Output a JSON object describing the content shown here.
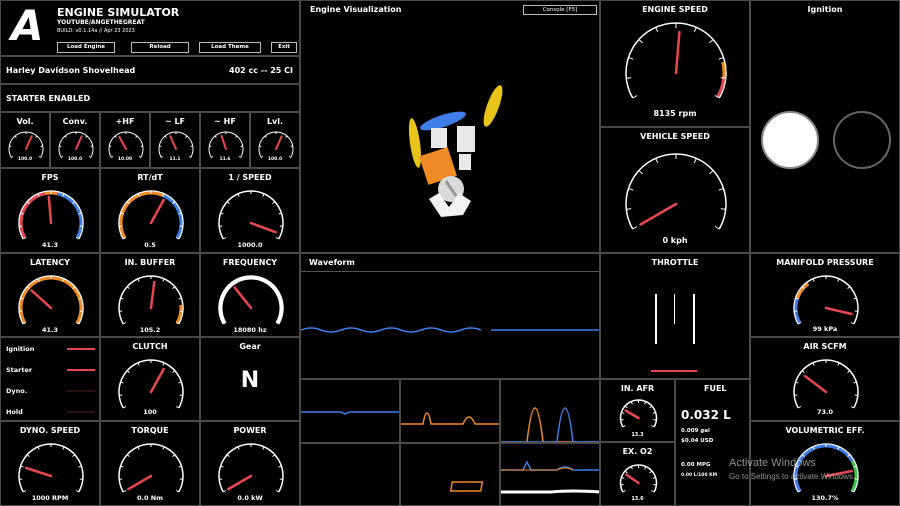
{
  "header": {
    "logo": "A",
    "title": "ENGINE SIMULATOR",
    "subtitle": "YOUTUBE/ANGETHEGREAT",
    "build": "BUILD: v0.1.14a // Apr 23 2023",
    "buttons": [
      "Load Engine",
      "Reload",
      "Load Theme",
      "Exit"
    ]
  },
  "engine": {
    "name": "Harley Davidson Shovelhead",
    "displacement": "402 cc -- 25 CI",
    "starter_status": "STARTER ENABLED"
  },
  "visualization": {
    "title": "Engine Visualization",
    "console_label": "Console [F5]"
  },
  "waveform": {
    "title": "Waveform"
  },
  "ignition": {
    "title": "Ignition"
  },
  "small_gauges": [
    {
      "label": "Vol.",
      "value": "100.0",
      "fraction": 0.6
    },
    {
      "label": "Conv.",
      "value": "100.0",
      "fraction": 0.6
    },
    {
      "label": "+HF",
      "value": "10.00",
      "fraction": 0.38
    },
    {
      "label": "~ LF",
      "value": "11.1",
      "fraction": 0.4
    },
    {
      "label": "~ HF",
      "value": "11.6",
      "fraction": 0.42
    },
    {
      "label": "Lvl.",
      "value": "100.0",
      "fraction": 0.6
    }
  ],
  "gauges": {
    "fps": {
      "label": "FPS",
      "value": "41.3",
      "fraction": 0.48
    },
    "rtdt": {
      "label": "RT/dT",
      "value": "0.5",
      "fraction": 0.62
    },
    "speed_inv": {
      "label": "1 / SPEED",
      "value": "1000.0",
      "fraction": 0.96
    },
    "latency": {
      "label": "LATENCY",
      "value": "41.3",
      "fraction": 0.3
    },
    "inbuffer": {
      "label": "IN. BUFFER",
      "value": "105.2",
      "fraction": 0.53
    },
    "frequency": {
      "label": "FREQUENCY",
      "value": "18080 hz",
      "fraction": 0.34
    },
    "engine_speed": {
      "label": "ENGINE SPEED",
      "value": "8135 rpm",
      "fraction": 0.52
    },
    "vehicle_speed": {
      "label": "VEHICLE SPEED",
      "value": "0 kph",
      "fraction": 0.0
    },
    "clutch": {
      "label": "CLUTCH",
      "value": "100",
      "fraction": 0.62
    },
    "dyno_speed": {
      "label": "DYNO. SPEED",
      "value": "1000 RPM",
      "fraction": 0.2
    },
    "torque": {
      "label": "TORQUE",
      "value": "0.0 Nm",
      "fraction": 0.0
    },
    "power": {
      "label": "POWER",
      "value": "0.0 kW",
      "fraction": 0.0
    },
    "manifold": {
      "label": "MANIFOLD PRESSURE",
      "value": "99 kPa",
      "fraction": 0.93
    },
    "air_scfm": {
      "label": "AIR SCFM",
      "value": "73.0",
      "fraction": 0.28
    },
    "vol_eff": {
      "label": "VOLUMETRIC EFF.",
      "value": "130.7%",
      "fraction": 0.83
    },
    "in_afr": {
      "label": "IN. AFR",
      "value": "13.3",
      "fraction": 0.25
    },
    "ex_o2": {
      "label": "EX. O2",
      "value": "13.6",
      "fraction": 0.27
    }
  },
  "status_list": [
    {
      "label": "Ignition",
      "active": true
    },
    {
      "label": "Starter",
      "active": true
    },
    {
      "label": "Dyno.",
      "active": false
    },
    {
      "label": "Hold",
      "active": false
    }
  ],
  "gear": {
    "label": "Gear",
    "value": "N"
  },
  "throttle": {
    "label": "THROTTLE"
  },
  "fuel": {
    "label": "FUEL",
    "liters": "0.032 L",
    "gallons": "0.009 gal",
    "cost": "$0.04 USD",
    "mpg": "0.00 MPG",
    "l100": "0.00 L/100 KM"
  },
  "watermark": {
    "line1": "Activate Windows",
    "line2": "Go to Settings to activate Windows."
  },
  "colors": {
    "needle": "#e8474f",
    "orange": "#f08a24",
    "blue": "#3f7ee8",
    "green": "#3cc24a",
    "border": "#4a4a4a"
  }
}
